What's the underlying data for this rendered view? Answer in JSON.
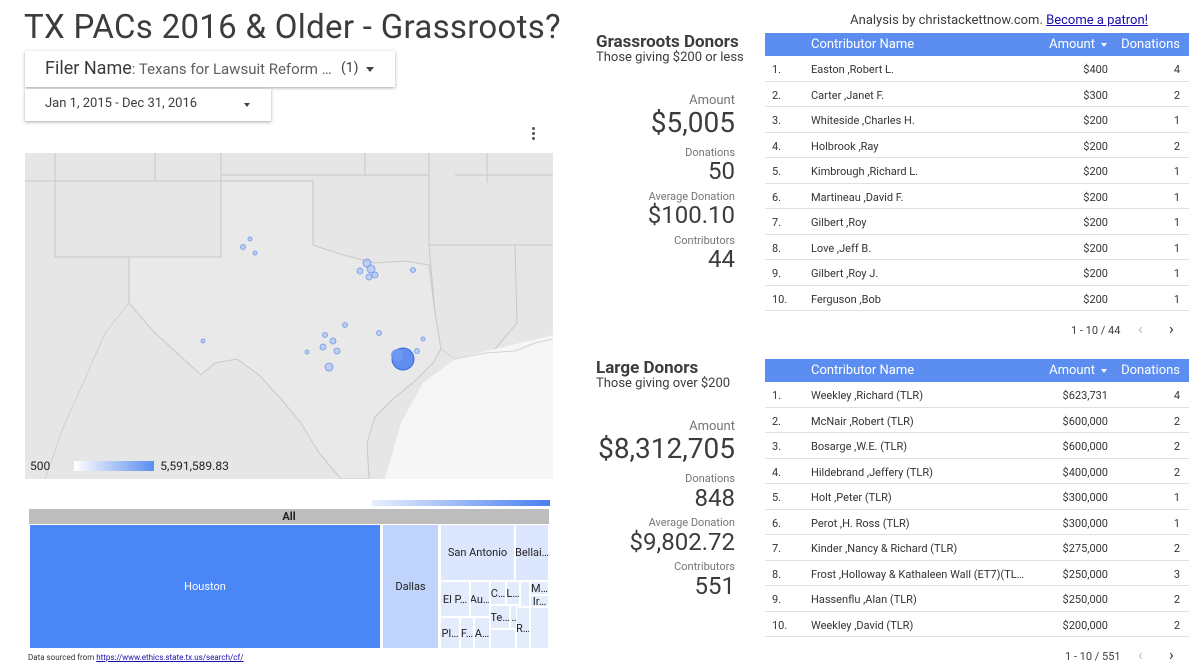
{
  "title": "TX PACs 2016 & Older - Grassroots?",
  "filters": {
    "filer_label": "Filer Name",
    "filer_value": ": Texans for Lawsuit Reform …",
    "filer_count": "(1)",
    "date_range": "Jan 1, 2015 - Dec 31, 2016"
  },
  "map": {
    "legend_min": "500",
    "legend_max": "5,591,589.83",
    "colors": {
      "land": "#e6e6e6",
      "bubble": "#5b8ef0"
    }
  },
  "treemap": {
    "root": "All",
    "cells": [
      "Houston",
      "Dallas",
      "San Antonio",
      "Bellai…",
      "El P…",
      "Au…",
      "C…",
      "L…",
      "M…",
      "Ir…",
      "Te…",
      "…",
      "Pl…",
      "F…",
      "A…",
      "R…"
    ]
  },
  "source": {
    "prefix": "Data sourced from",
    "link": "https://www.ethics.state.tx.us/search/cf/"
  },
  "attribution": {
    "text": "Analysis by christackettnow.com.",
    "link": "Become a patron!"
  },
  "grassroots": {
    "title": "Grassroots Donors",
    "subtitle": "Those giving $200 or less",
    "amount_label": "Amount",
    "amount": "$5,005",
    "donations_label": "Donations",
    "donations": "50",
    "avg_label": "Average Donation",
    "avg": "$100.10",
    "contributors_label": "Contributors",
    "contributors": "44",
    "columns": {
      "name": "Contributor Name",
      "amount": "Amount",
      "donations": "Donations"
    },
    "rows": [
      {
        "idx": "1.",
        "name": "Easton ,Robert L.",
        "amount": "$400",
        "donations": "4"
      },
      {
        "idx": "2.",
        "name": "Carter ,Janet F.",
        "amount": "$300",
        "donations": "2"
      },
      {
        "idx": "3.",
        "name": "Whiteside ,Charles H.",
        "amount": "$200",
        "donations": "1"
      },
      {
        "idx": "4.",
        "name": "Holbrook ,Ray",
        "amount": "$200",
        "donations": "2"
      },
      {
        "idx": "5.",
        "name": "Kimbrough ,Richard L.",
        "amount": "$200",
        "donations": "1"
      },
      {
        "idx": "6.",
        "name": "Martineau ,David F.",
        "amount": "$200",
        "donations": "1"
      },
      {
        "idx": "7.",
        "name": "Gilbert ,Roy",
        "amount": "$200",
        "donations": "1"
      },
      {
        "idx": "8.",
        "name": "Love ,Jeff B.",
        "amount": "$200",
        "donations": "1"
      },
      {
        "idx": "9.",
        "name": "Gilbert ,Roy J.",
        "amount": "$200",
        "donations": "1"
      },
      {
        "idx": "10.",
        "name": "Ferguson ,Bob",
        "amount": "$200",
        "donations": "1"
      }
    ],
    "pagination": "1 - 10 / 44"
  },
  "large": {
    "title": "Large Donors",
    "subtitle": "Those giving over $200",
    "amount_label": "Amount",
    "amount": "$8,312,705",
    "donations_label": "Donations",
    "donations": "848",
    "avg_label": "Average Donation",
    "avg": "$9,802.72",
    "contributors_label": "Contributors",
    "contributors": "551",
    "columns": {
      "name": "Contributor Name",
      "amount": "Amount",
      "donations": "Donations"
    },
    "rows": [
      {
        "idx": "1.",
        "name": "Weekley ,Richard (TLR)",
        "amount": "$623,731",
        "donations": "4"
      },
      {
        "idx": "2.",
        "name": "McNair ,Robert (TLR)",
        "amount": "$600,000",
        "donations": "2"
      },
      {
        "idx": "3.",
        "name": "Bosarge ,W.E. (TLR)",
        "amount": "$600,000",
        "donations": "2"
      },
      {
        "idx": "4.",
        "name": "Hildebrand ,Jeffery (TLR)",
        "amount": "$400,000",
        "donations": "2"
      },
      {
        "idx": "5.",
        "name": "Holt ,Peter (TLR)",
        "amount": "$300,000",
        "donations": "1"
      },
      {
        "idx": "6.",
        "name": "Perot ,H. Ross (TLR)",
        "amount": "$300,000",
        "donations": "1"
      },
      {
        "idx": "7.",
        "name": "Kinder ,Nancy & Richard (TLR)",
        "amount": "$275,000",
        "donations": "2"
      },
      {
        "idx": "8.",
        "name": "Frost ,Holloway & Kathaleen Wall (ET7)(TL…",
        "amount": "$250,000",
        "donations": "3"
      },
      {
        "idx": "9.",
        "name": "Hassenflu ,Alan (TLR)",
        "amount": "$250,000",
        "donations": "2"
      },
      {
        "idx": "10.",
        "name": "Weekley ,David (TLR)",
        "amount": "$200,000",
        "donations": "2"
      }
    ],
    "pagination": "1 - 10 / 551"
  },
  "icons": [
    "caret-down-icon",
    "more-vert-icon",
    "chevron-left-icon",
    "chevron-right-icon"
  ]
}
